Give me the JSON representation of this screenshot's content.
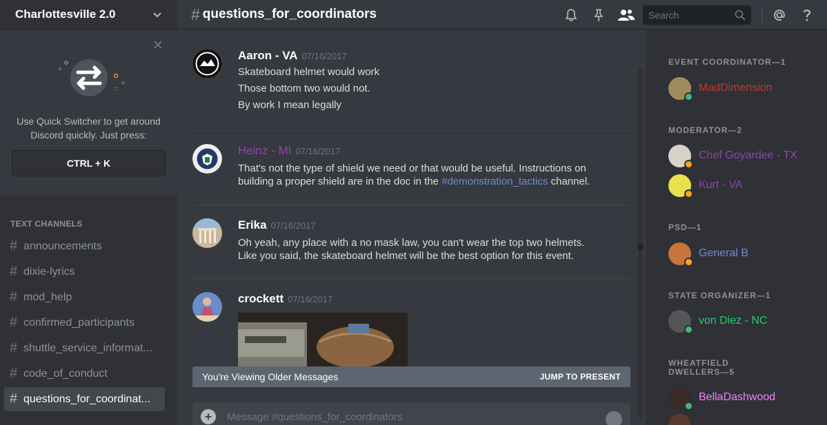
{
  "server": {
    "name": "Charlottesville 2.0"
  },
  "quick_switcher": {
    "text_line1": "Use Quick Switcher to get around",
    "text_line2": "Discord quickly. Just press:",
    "key": "CTRL + K"
  },
  "channels": {
    "category": "TEXT CHANNELS",
    "items": [
      {
        "label": "announcements"
      },
      {
        "label": "dixie-lyrics"
      },
      {
        "label": "mod_help"
      },
      {
        "label": "confirmed_participants"
      },
      {
        "label": "shuttle_service_informat..."
      },
      {
        "label": "code_of_conduct"
      },
      {
        "label": "questions_for_coordinat..."
      }
    ]
  },
  "header": {
    "hash": "#",
    "channel": "questions_for_coordinators"
  },
  "search": {
    "placeholder": "Search"
  },
  "messages": [
    {
      "author": "Aaron - VA",
      "timestamp": "07/16/2017",
      "author_color": "#ffffff",
      "lines": [
        "Skateboard helmet would work",
        "Those bottom two would not.",
        "By work I mean legally"
      ]
    },
    {
      "author": "Heinz - MI",
      "timestamp": "07/16/2017",
      "author_color": "#8e44ad",
      "line1": "That's not the type of shield we need or that would be useful. Instructions on",
      "line2_pre": "building a proper shield are in the doc in the ",
      "mention": "#demonstration_tactics",
      "line2_post": " channel."
    },
    {
      "author": "Erika",
      "timestamp": "07/16/2017",
      "author_color": "#ffffff",
      "lines": [
        "Oh yeah, any place with a no mask law, you can't wear the top two helmets.",
        "Like you said, the skateboard helmet will be the best option for this event."
      ]
    },
    {
      "author": "crockett",
      "timestamp": "07/16/2017",
      "author_color": "#ffffff",
      "lines": []
    }
  ],
  "older_bar": {
    "text": "You're Viewing Older Messages",
    "jump": "JUMP TO PRESENT"
  },
  "composer": {
    "placeholder": "Message #questions_for_coordinators"
  },
  "members": {
    "roles": [
      {
        "label": "EVENT COORDINATOR—1",
        "members": [
          {
            "name": "MadDimension",
            "color": "#c0392b",
            "status": "#43b581"
          }
        ]
      },
      {
        "label": "MODERATOR—2",
        "members": [
          {
            "name": "Chef Goyardee - TX",
            "color": "#8e44ad",
            "status": "#faa61a"
          },
          {
            "name": "Kurt - VA",
            "color": "#8e44ad",
            "status": "#faa61a"
          }
        ]
      },
      {
        "label": "PSD—1",
        "members": [
          {
            "name": "General B",
            "color": "#7289da",
            "status": "#faa61a"
          }
        ]
      },
      {
        "label": "STATE ORGANIZER—1",
        "members": [
          {
            "name": "von Diez - NC",
            "color": "#2ecc71",
            "status": "#43b581"
          }
        ]
      },
      {
        "label_line1": "WHEATFIELD",
        "label_line2": "DWELLERS—5",
        "members": [
          {
            "name": "BellaDashwood",
            "color": "#f47fff",
            "status": "#43b581"
          }
        ]
      }
    ]
  }
}
